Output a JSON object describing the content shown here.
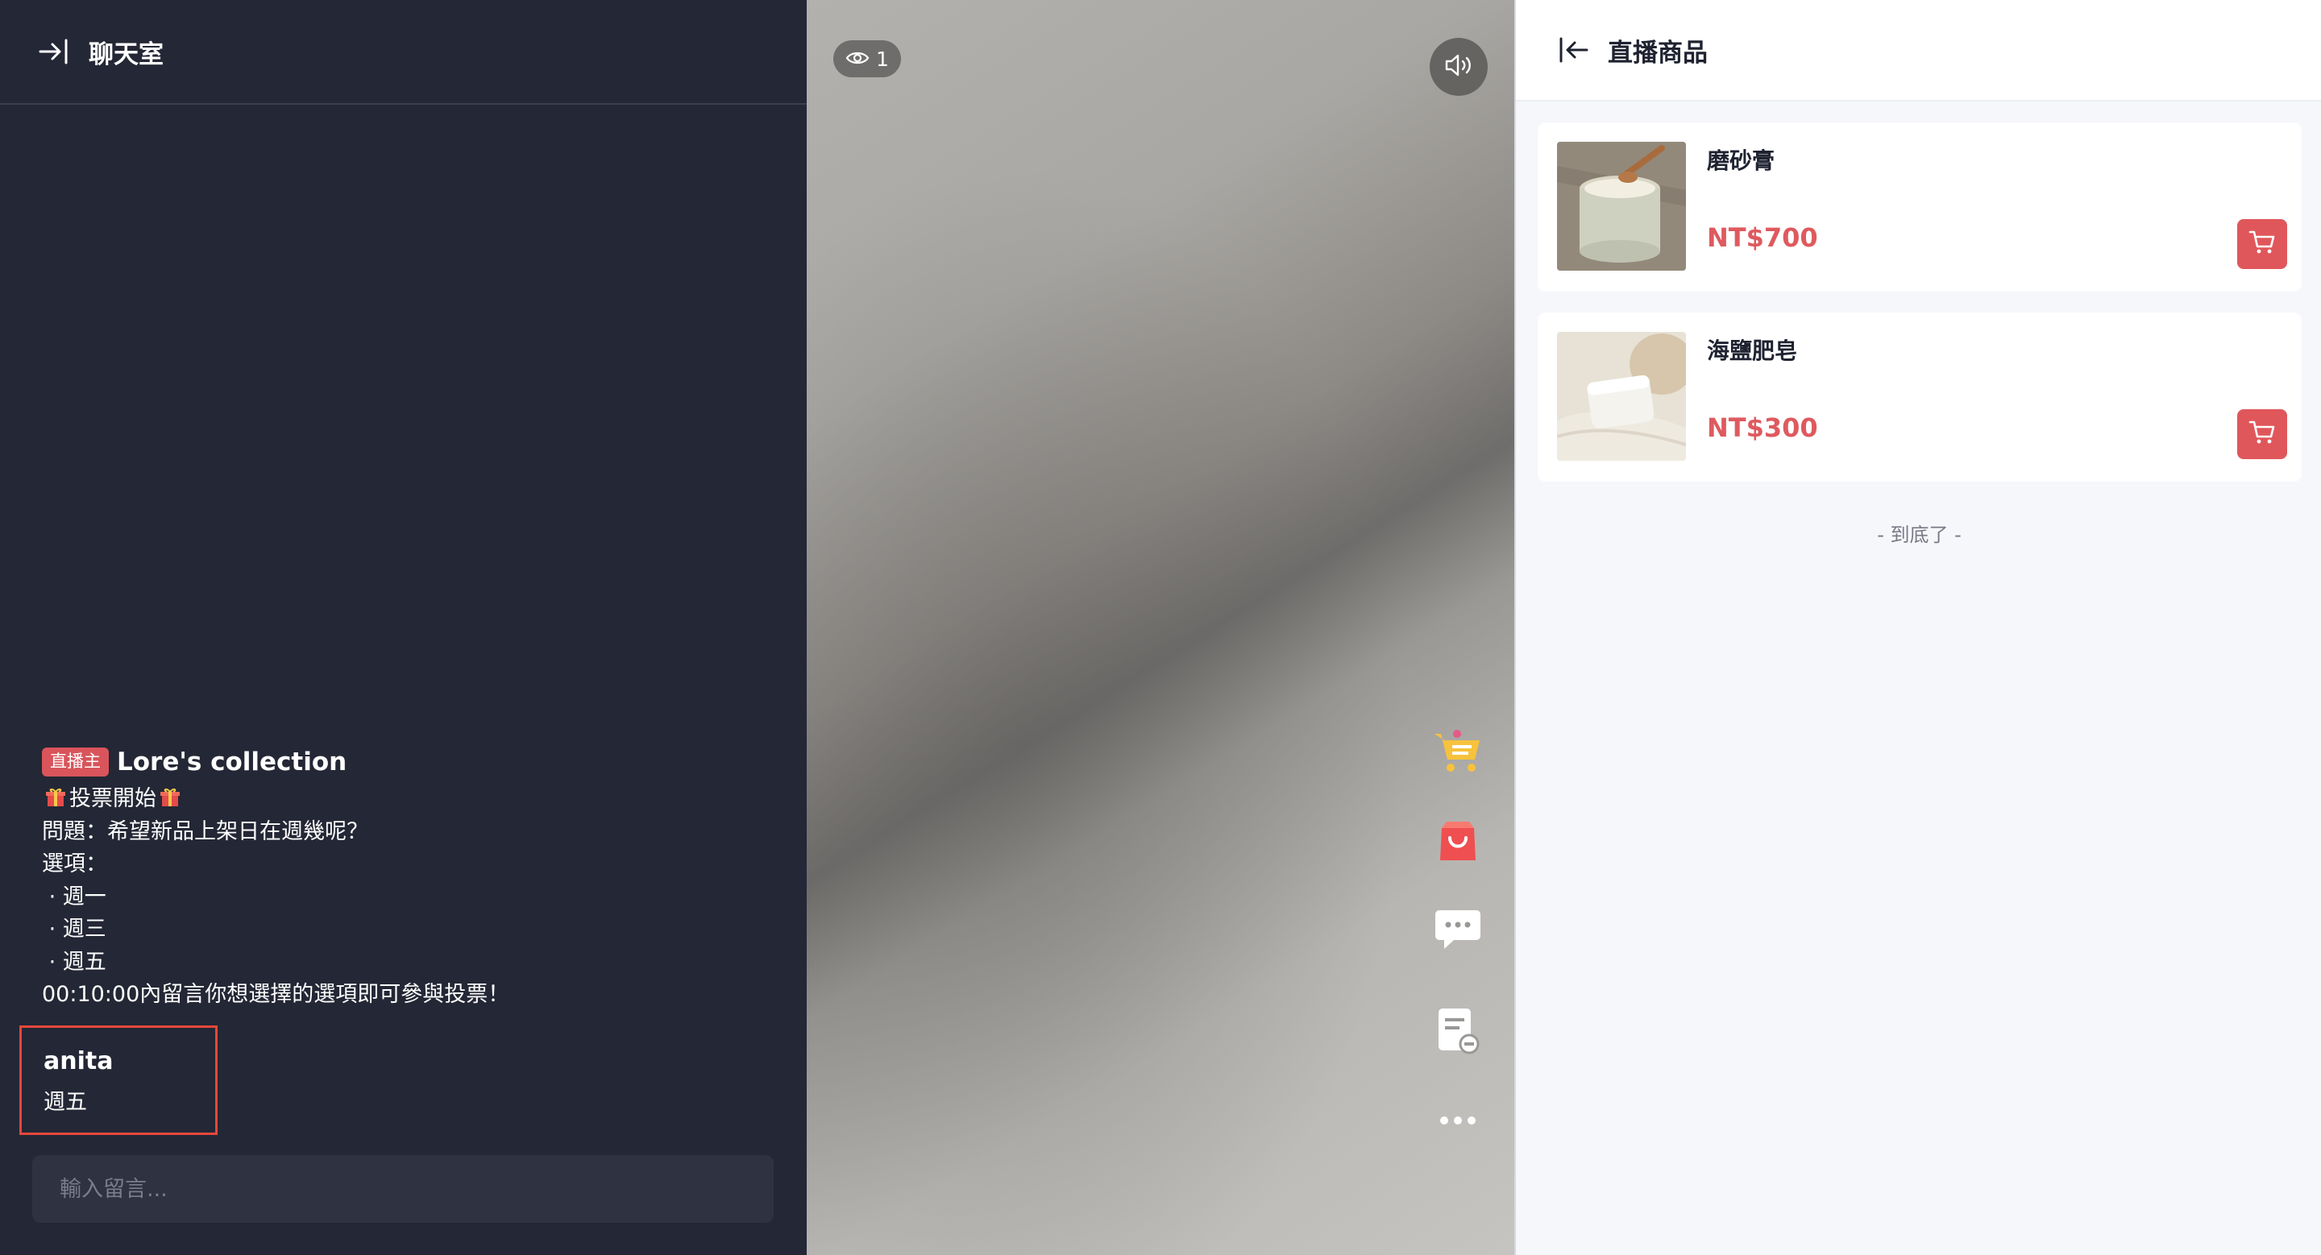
{
  "chat": {
    "title": "聊天室",
    "host_badge": "直播主",
    "host_name": "Lore's collection",
    "poll_title": "投票開始",
    "poll_lines": [
      "問題：希望新品上架日在週幾呢？",
      "選項：",
      " · 週一",
      " · 週三",
      " · 週五",
      "00:10:00內留言你想選擇的選項即可參與投票！"
    ],
    "viewer_message": {
      "name": "anita",
      "text": "週五"
    },
    "input_placeholder": "輸入留言..."
  },
  "video": {
    "viewer_count": "1",
    "side_icons": [
      "cart-list-icon",
      "shopping-bag-icon",
      "comment-icon",
      "notes-icon",
      "more-icon"
    ]
  },
  "products": {
    "title": "直播商品",
    "items": [
      {
        "name": "磨砂膏",
        "price": "NT$700"
      },
      {
        "name": "海鹽肥皂",
        "price": "NT$300"
      }
    ],
    "end_note": "- 到底了 -"
  },
  "colors": {
    "chat_bg": "#242735",
    "accent_red": "#de5a5e",
    "highlight_border": "#e6473a",
    "product_bg": "#f6f7fb"
  }
}
